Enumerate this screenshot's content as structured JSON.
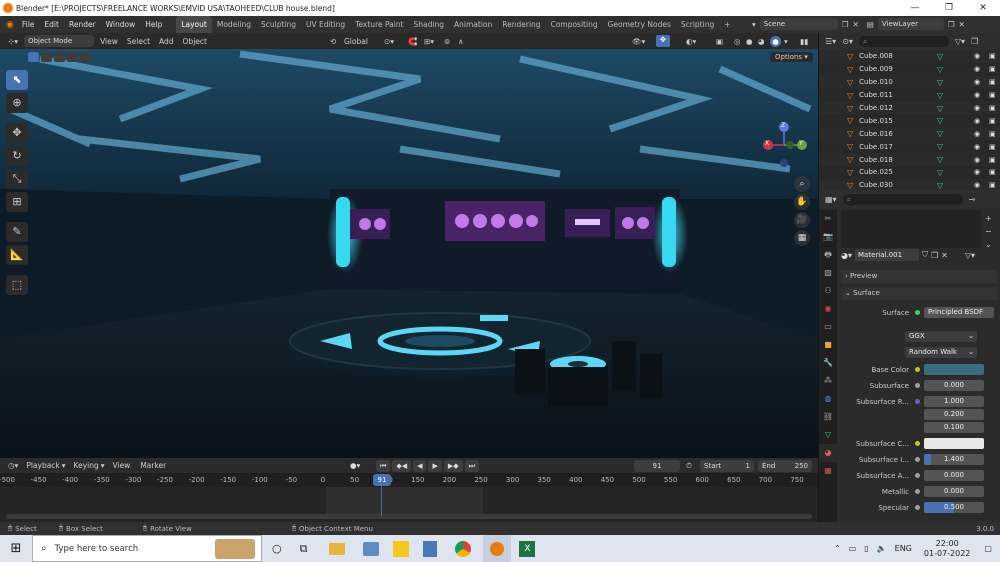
{
  "window": {
    "title": "Blender* [E:\\PROJECTS\\FREELANCE WORKS\\EMVID USA\\TAOHEED\\CLUB house.blend]",
    "controls": [
      "—",
      "❐",
      "✕"
    ]
  },
  "menu": [
    "File",
    "Edit",
    "Render",
    "Window",
    "Help"
  ],
  "workspaces": [
    "Layout",
    "Modeling",
    "Sculpting",
    "UV Editing",
    "Texture Paint",
    "Shading",
    "Animation",
    "Rendering",
    "Compositing",
    "Geometry Nodes",
    "Scripting"
  ],
  "scene": {
    "label": "Scene",
    "view_layer": "ViewLayer"
  },
  "viewport_header": {
    "mode": "Object Mode",
    "menus": [
      "View",
      "Select",
      "Add",
      "Object"
    ],
    "orientation": "Global",
    "options": "Options"
  },
  "gizmo": {
    "x": "X",
    "y": "Y",
    "z": "Z"
  },
  "outliner": {
    "items": [
      "Cube.008",
      "Cube.009",
      "Cube.010",
      "Cube.011",
      "Cube.012",
      "Cube.015",
      "Cube.016",
      "Cube.017",
      "Cube.018",
      "Cube.025",
      "Cube.030"
    ]
  },
  "properties": {
    "material": "Material.001",
    "preview": "Preview",
    "surface_section": "Surface",
    "surface_label": "Surface",
    "surface_value": "Principled BSDF",
    "distribution": "GGX",
    "subsurface_method": "Random Walk",
    "base_color_label": "Base Color",
    "base_color": "#3a6e7e",
    "rows": [
      {
        "label": "Subsurface",
        "value": "0.000"
      },
      {
        "label": "Subsurface R...",
        "value": "1.000"
      },
      {
        "label": "",
        "value": "0.200"
      },
      {
        "label": "",
        "value": "0.100"
      },
      {
        "label": "Subsurface C...",
        "value": ""
      },
      {
        "label": "Subsurface I...",
        "value": "1.400"
      },
      {
        "label": "Subsurface A...",
        "value": "0.000"
      },
      {
        "label": "Metallic",
        "value": "0.000"
      },
      {
        "label": "Specular",
        "value": "0.500"
      }
    ]
  },
  "timeline": {
    "menus": [
      "Playback",
      "Keying",
      "View",
      "Marker"
    ],
    "current_frame": "91",
    "start_label": "Start",
    "start": "1",
    "end_label": "End",
    "end": "250",
    "ticks": [
      "-500",
      "-450",
      "-400",
      "-350",
      "-300",
      "-250",
      "-200",
      "-150",
      "-100",
      "-50",
      "0",
      "50",
      "100",
      "150",
      "200",
      "250",
      "300",
      "350",
      "400",
      "450",
      "500",
      "550",
      "600",
      "650",
      "700",
      "750"
    ]
  },
  "status": {
    "select": "Select",
    "box_select": "Box Select",
    "rotate": "Rotate View",
    "context": "Object Context Menu",
    "version": "3.0.0"
  },
  "taskbar": {
    "search_placeholder": "Type here to search",
    "lang": "ENG",
    "time": "22:00",
    "date": "01-07-2022"
  }
}
